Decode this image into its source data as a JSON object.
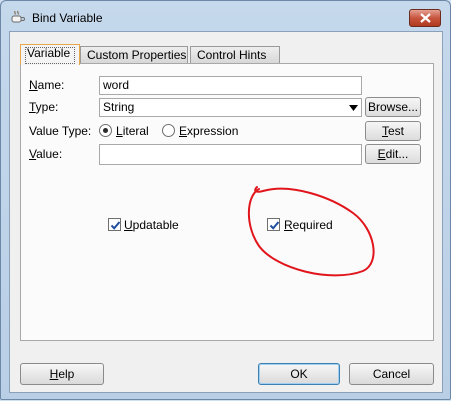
{
  "window": {
    "title": "Bind Variable",
    "close_icon": "close-icon"
  },
  "tabs": [
    {
      "label": "Variable",
      "active": true
    },
    {
      "label": "Custom Properties",
      "active": false
    },
    {
      "label": "Control Hints",
      "active": false
    }
  ],
  "form": {
    "name_label": "Name:",
    "name_mnemonic": "N",
    "name_rest": "ame:",
    "name_value": "word",
    "type_mnemonic": "T",
    "type_rest": "ype:",
    "type_value": "String",
    "browse_label": "Browse...",
    "value_type_label": "Value Type:",
    "literal_mnemonic": "L",
    "literal_rest": "iteral",
    "expression_mnemonic": "E",
    "expression_rest": "xpression",
    "value_type_selected": "Literal",
    "test_prefix": "",
    "test_mnemonic": "T",
    "test_rest": "est",
    "value_mnemonic": "V",
    "value_rest": "alue:",
    "value_value": "",
    "edit_mnemonic": "E",
    "edit_rest": "dit...",
    "updatable_mnemonic": "U",
    "updatable_rest": "pdatable",
    "updatable_checked": true,
    "required_mnemonic": "R",
    "required_rest": "equired",
    "required_checked": true
  },
  "footer": {
    "help_mnemonic": "H",
    "help_rest": "elp",
    "ok_label": "OK",
    "cancel_label": "Cancel"
  },
  "colors": {
    "annotation": "#e0161c",
    "active_tab_border": "#e8a64a"
  }
}
